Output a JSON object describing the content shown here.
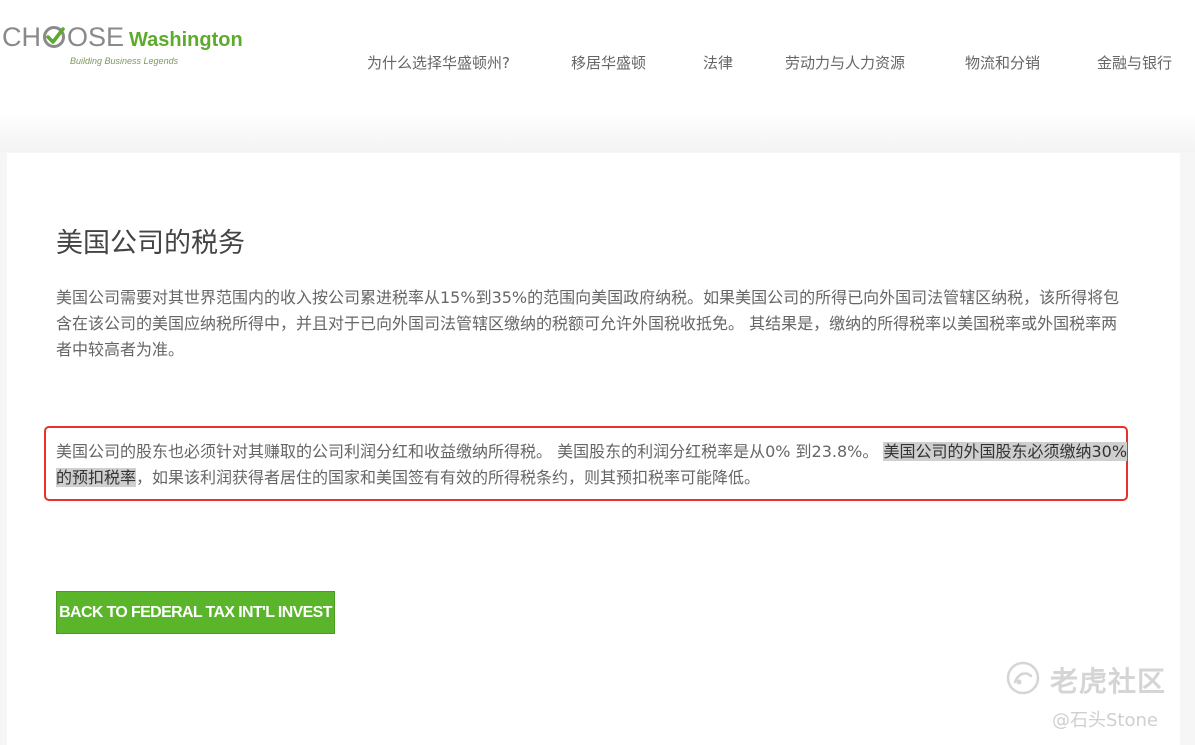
{
  "header": {
    "logo": {
      "choose_prefix": "CH",
      "choose_suffix": "OSE",
      "washington": "Washington",
      "tagline": "Building Business Legends"
    },
    "nav": [
      {
        "label": "为什么选择华盛顿州?"
      },
      {
        "label": "移居华盛顿"
      },
      {
        "label": "法律"
      },
      {
        "label": "劳动力与人力资源"
      },
      {
        "label": "物流和分销"
      },
      {
        "label": "金融与银行"
      }
    ]
  },
  "main": {
    "title": "美国公司的税务",
    "paragraph1": "美国公司需要对其世界范围内的收入按公司累进税率从15%到35%的范围向美国政府纳税。如果美国公司的所得已向外国司法管辖区纳税，该所得将包含在该公司的美国应纳税所得中，并且对于已向外国司法管辖区缴纳的税额可允许外国税收抵免。 其结果是，缴纳的所得税率以美国税率或外国税率两者中较高者为准。",
    "paragraph2": {
      "part1": "美国公司的股东也必须针对其赚取的公司利润分红和收益缴纳所得税。 美国股东的利润分红税率是从0% 到23.8%。 ",
      "highlighted": "美国公司的外国股东必须缴纳30%的预扣税率",
      "part2": "，如果该利润获得者居住的国家和美国签有有效的所得税条约，则其预扣税率可能降低。"
    },
    "back_button": "BACK TO FEDERAL TAX INT'L INVEST"
  },
  "watermark": {
    "site": "老虎社区",
    "credit": "@石头Stone"
  },
  "colors": {
    "brand_green": "#5cab2a",
    "button_green": "#5ab52a",
    "highlight_border": "#e8312e",
    "text_highlight": "#cfcfcf"
  }
}
